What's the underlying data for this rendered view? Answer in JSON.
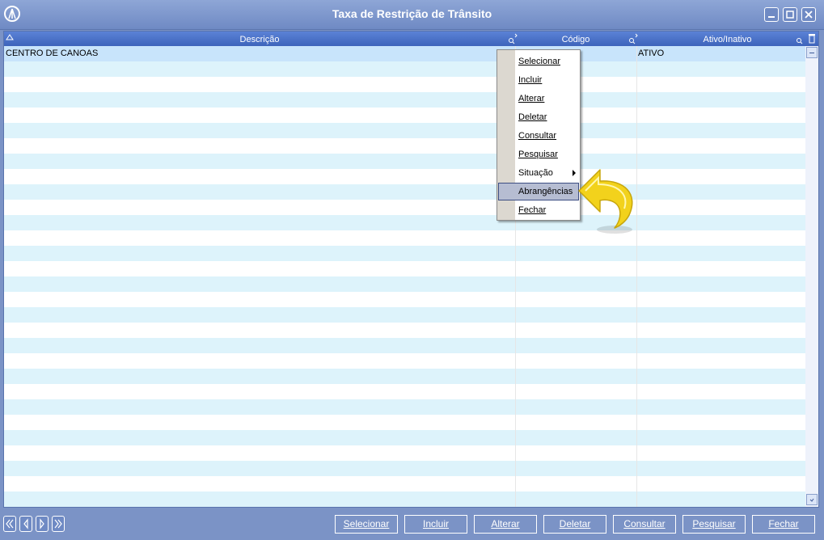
{
  "window": {
    "title": "Taxa de Restrição de Trânsito",
    "icons": [
      "app-logo-icon",
      "minimize-icon",
      "maximize-icon",
      "close-icon"
    ]
  },
  "grid": {
    "columns": [
      {
        "label": "Descrição"
      },
      {
        "label": "Código"
      },
      {
        "label": "Ativo/Inativo"
      }
    ],
    "rows": [
      {
        "descricao": "CENTRO DE CANOAS",
        "codigo": "",
        "ativo": "ATIVO"
      }
    ]
  },
  "context_menu": {
    "items": [
      {
        "label": "Selecionar",
        "accel": "S"
      },
      {
        "label": "Incluir",
        "accel": "I"
      },
      {
        "label": "Alterar",
        "accel": "A"
      },
      {
        "label": "Deletar",
        "accel": "D"
      },
      {
        "label": "Consultar",
        "accel": "C"
      },
      {
        "label": "Pesquisar",
        "accel": "P"
      },
      {
        "label": "Situação",
        "accel": "",
        "has_submenu": true
      },
      {
        "label": "Abrangências",
        "accel": "",
        "highlighted": true
      },
      {
        "label": "Fechar",
        "accel": "F"
      }
    ]
  },
  "footer": {
    "nav_icons": [
      "first-page-icon",
      "prev-page-icon",
      "next-page-icon",
      "last-page-icon"
    ],
    "buttons": [
      {
        "label": "Selecionar"
      },
      {
        "label": "Incluir"
      },
      {
        "label": "Alterar"
      },
      {
        "label": "Deletar"
      },
      {
        "label": "Consultar"
      },
      {
        "label": "Pesquisar"
      },
      {
        "label": "Fechar"
      }
    ]
  },
  "colors": {
    "window_bg": "#7b93c6",
    "header_bg": "#4a72c8",
    "row_alt": "#ddf3fb",
    "menu_highlight": "#b6bdd2",
    "pointer_arrow": "#f2d21c"
  }
}
